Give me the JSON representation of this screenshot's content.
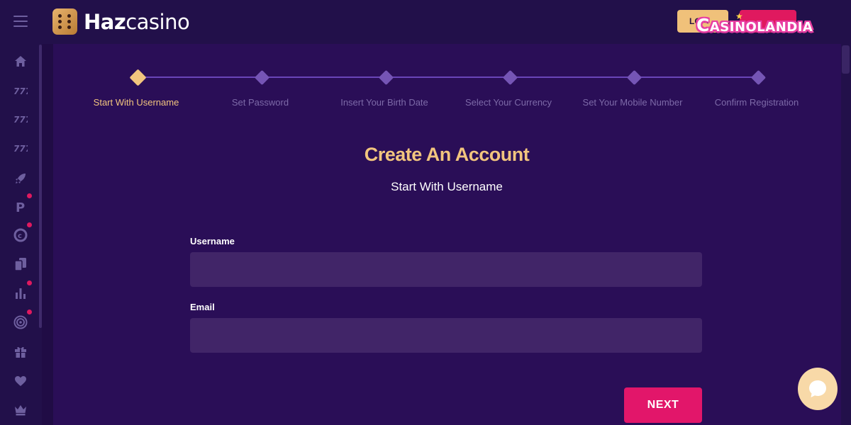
{
  "header": {
    "logo_bold": "Haz",
    "logo_light": "casino",
    "login_label": "LO",
    "signup_label": "",
    "watermark": "Casinolandia"
  },
  "sidebar": {
    "icons": [
      "home-icon",
      "slots-777-icon",
      "slots-777-icon",
      "slots-777-icon",
      "rocket-icon",
      "p-icon",
      "coin-icon",
      "cards-icon",
      "chart-icon",
      "target-icon",
      "gift-icon",
      "heart-icon",
      "crown-icon"
    ],
    "notifications_on": [
      "p-icon",
      "coin-icon",
      "chart-icon",
      "target-icon"
    ]
  },
  "stepper": {
    "steps": [
      {
        "label": "Start With Username",
        "active": true
      },
      {
        "label": "Set Password",
        "active": false
      },
      {
        "label": "Insert Your Birth Date",
        "active": false
      },
      {
        "label": "Select Your Currency",
        "active": false
      },
      {
        "label": "Set Your Mobile Number",
        "active": false
      },
      {
        "label": "Confirm Registration",
        "active": false
      }
    ]
  },
  "form": {
    "title": "Create An Account",
    "subtitle": "Start With Username",
    "username_label": "Username",
    "username_value": "",
    "email_label": "Email",
    "email_value": "",
    "next_label": "NEXT"
  },
  "colors": {
    "accent": "#f2c57e",
    "primary_button": "#e2166a",
    "background": "#2a0e57",
    "input_bg": "#412568"
  }
}
